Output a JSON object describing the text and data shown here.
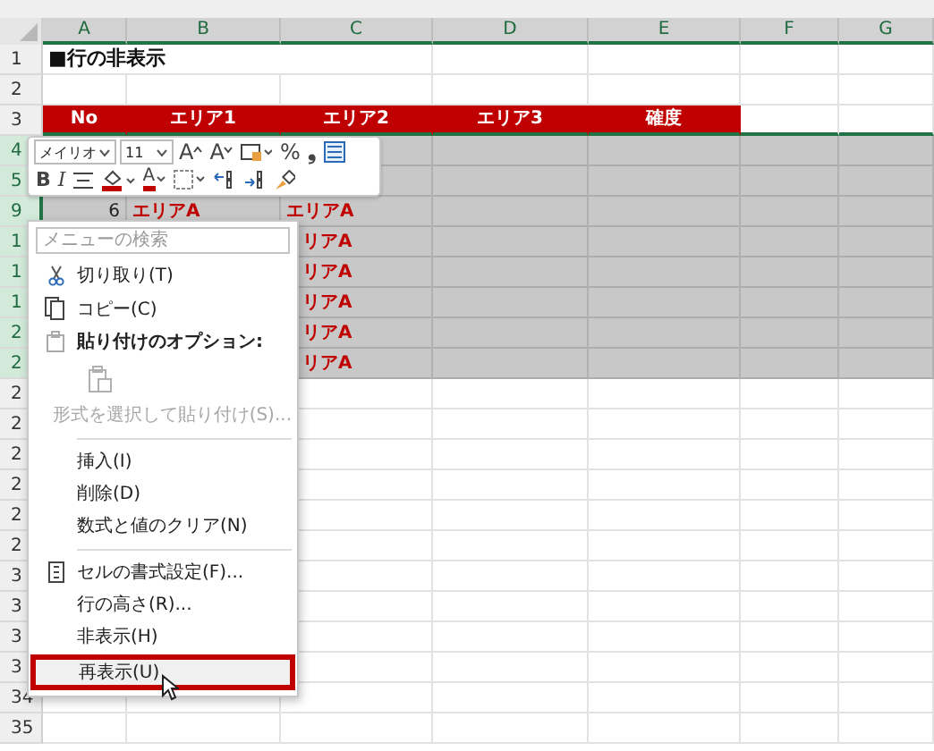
{
  "columns": [
    {
      "label": "A"
    },
    {
      "label": "B"
    },
    {
      "label": "C"
    },
    {
      "label": "D"
    },
    {
      "label": "E"
    },
    {
      "label": "F"
    },
    {
      "label": "G"
    }
  ],
  "rows": [
    {
      "label": "1",
      "kind": "title",
      "selected": false,
      "a": "■行の非表示"
    },
    {
      "label": "2",
      "kind": "blank",
      "selected": false
    },
    {
      "label": "3",
      "kind": "header",
      "selected": false,
      "a": "No",
      "b": "エリア1",
      "c": "エリア2",
      "d": "エリア3",
      "e": "確度"
    },
    {
      "label": "4",
      "kind": "data",
      "selected": true
    },
    {
      "label": "5",
      "kind": "data",
      "selected": true
    },
    {
      "label": "9",
      "kind": "data",
      "selected": true,
      "a": "6",
      "b": "エリアA",
      "c": "エリアA"
    },
    {
      "label": "1",
      "kind": "data",
      "selected": true,
      "c": "リアA"
    },
    {
      "label": "1",
      "kind": "data",
      "selected": true,
      "c": "リアA"
    },
    {
      "label": "1",
      "kind": "data",
      "selected": true,
      "c": "リアA"
    },
    {
      "label": "2",
      "kind": "data",
      "selected": true,
      "c": "リアA"
    },
    {
      "label": "2",
      "kind": "data",
      "selected": true,
      "c": "リアA"
    },
    {
      "label": "2",
      "kind": "blank",
      "selected": false
    },
    {
      "label": "2",
      "kind": "blank",
      "selected": false
    },
    {
      "label": "2",
      "kind": "blank",
      "selected": false
    },
    {
      "label": "2",
      "kind": "blank",
      "selected": false
    },
    {
      "label": "2",
      "kind": "blank",
      "selected": false
    },
    {
      "label": "2",
      "kind": "blank",
      "selected": false
    },
    {
      "label": "3",
      "kind": "blank",
      "selected": false
    },
    {
      "label": "3",
      "kind": "blank",
      "selected": false
    },
    {
      "label": "3",
      "kind": "blank",
      "selected": false
    },
    {
      "label": "3",
      "kind": "blank",
      "selected": false
    },
    {
      "label": "34",
      "kind": "blank",
      "selected": false
    },
    {
      "label": "35",
      "kind": "blank",
      "selected": false
    }
  ],
  "mini_toolbar": {
    "controls": [
      {
        "kind": "font",
        "value": "メイリオ"
      },
      {
        "kind": "size",
        "value": "11"
      },
      {
        "kind": "grow",
        "label": "A"
      },
      {
        "kind": "shrink",
        "label": "A"
      },
      {
        "kind": "accounting"
      },
      {
        "kind": "percent",
        "label": "%"
      },
      {
        "kind": "comma",
        "label": "❟"
      },
      {
        "kind": "wrap"
      },
      {
        "kind": "bold",
        "label": "B"
      },
      {
        "kind": "italic",
        "label": "I"
      },
      {
        "kind": "align"
      },
      {
        "kind": "fill"
      },
      {
        "kind": "fontcolor",
        "label": "A"
      },
      {
        "kind": "borders"
      },
      {
        "kind": "inc-decimal"
      },
      {
        "kind": "dec-decimal"
      },
      {
        "kind": "painter"
      }
    ]
  },
  "context_menu": {
    "search": {
      "placeholder": "メニューの検索"
    },
    "items": [
      {
        "kind": "cut",
        "text": "切り取り(T)",
        "disabled": false,
        "selected": false
      },
      {
        "kind": "copy",
        "text": "コピー(C)",
        "disabled": false,
        "selected": false
      },
      {
        "kind": "heading",
        "text": "貼り付けのオプション:",
        "disabled": false,
        "selected": false
      },
      {
        "kind": "paste-icons",
        "disabled": true,
        "selected": false
      },
      {
        "kind": "item",
        "text": "形式を選択して貼り付け(S)...",
        "disabled": true,
        "selected": false
      },
      {
        "kind": "separator"
      },
      {
        "kind": "item",
        "text": "挿入(I)",
        "disabled": false,
        "selected": false
      },
      {
        "kind": "item",
        "text": "削除(D)",
        "disabled": false,
        "selected": false
      },
      {
        "kind": "item",
        "text": "数式と値のクリア(N)",
        "disabled": false,
        "selected": false
      },
      {
        "kind": "separator"
      },
      {
        "kind": "format",
        "text": "セルの書式設定(F)...",
        "disabled": false,
        "selected": false
      },
      {
        "kind": "item",
        "text": "行の高さ(R)...",
        "disabled": false,
        "selected": false
      },
      {
        "kind": "item",
        "text": "非表示(H)",
        "disabled": false,
        "selected": false
      },
      {
        "kind": "item",
        "text": "再表示(U)",
        "disabled": false,
        "selected": true
      }
    ]
  }
}
